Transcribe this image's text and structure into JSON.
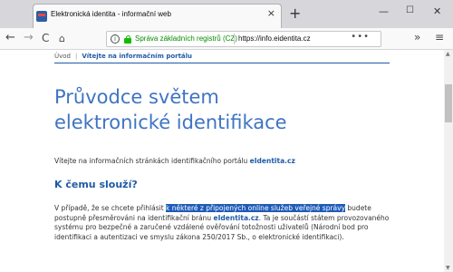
{
  "browser": {
    "tab_title": "Elektronická identita - informační web",
    "tab_close": "×",
    "new_tab": "+",
    "window_controls": {
      "minimize": "—",
      "maximize": "☐",
      "close": "✕"
    },
    "nav": {
      "back": "←",
      "forward": "→",
      "reload": "C",
      "home": "⌂"
    },
    "urlbar": {
      "info": "i",
      "site_identity": "Správa základních registrů (CZ)",
      "url": "https://info.eidentita.cz",
      "menu": "•••"
    },
    "overflow": "»",
    "menu": "≡"
  },
  "page": {
    "breadcrumb": {
      "home": "Úvod",
      "separator": "|",
      "current": "Vítejte na informačním portálu"
    },
    "hero_title_line1": "Průvodce světem",
    "hero_title_line2": "elektronické identifikace",
    "welcome_prefix": "Vítejte na informačních stránkách identifikačního portálu ",
    "welcome_link": "eIdentita.cz",
    "section_title": "K čemu slouží?",
    "para_part1": "V případě, že se chcete přihlásit ",
    "para_highlight": "k některé z připojených online služeb veřejné správy",
    "para_part2": " budete postupně přesměrováni na identifikační bránu ",
    "para_link": "eIdentita.cz",
    "para_part3": ". Ta je součástí státem provozovaného systému pro bezpečné a zaručené vzdálené ověřování totožnosti uživatelů (Národní bod pro identifikaci a autentizaci ve smyslu zákona 250/2017 Sb., o elektronické identifikaci)."
  },
  "scrollbar": {
    "up": "▲",
    "down": "▼"
  },
  "colors": {
    "brand_blue": "#1f5aa6",
    "hero_blue": "#3f74c2",
    "secure_green": "#058b00",
    "selection": "#1e5bb8"
  }
}
